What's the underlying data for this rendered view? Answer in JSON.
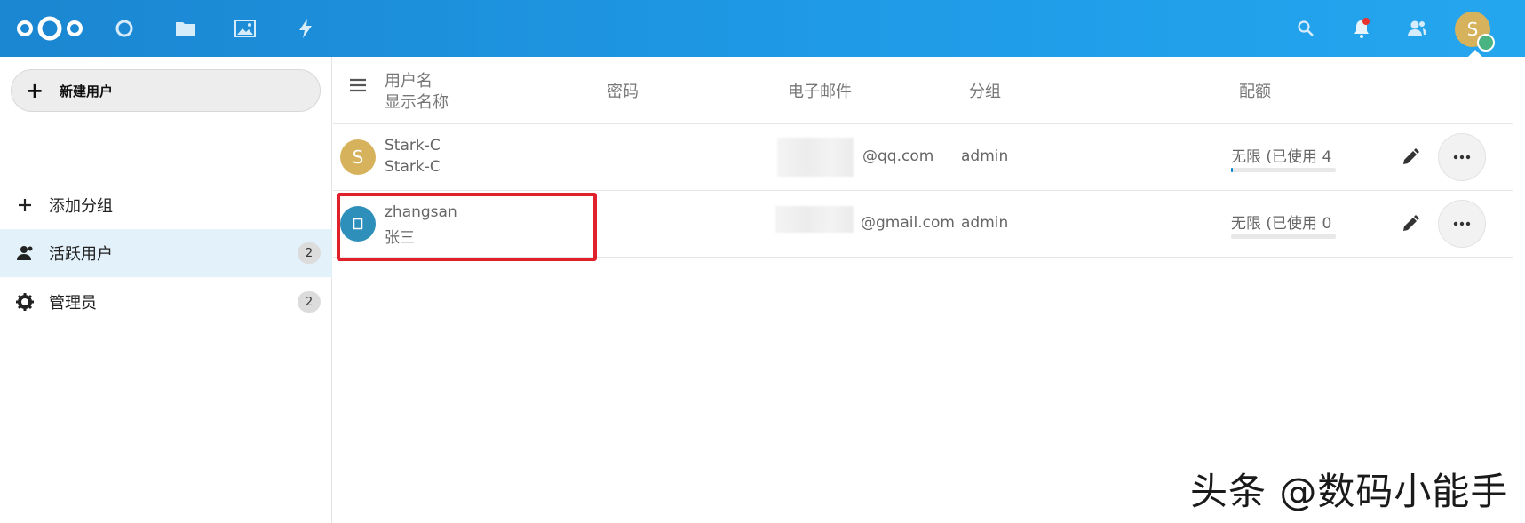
{
  "colors": {
    "header": "#1f9ae6",
    "accent": "#0082c9",
    "highlight": "#e0202a",
    "avatar_stark": "#d7b25c",
    "avatar_zhangsan": "#2e8fba",
    "notification_dot": "#e9322d",
    "status_online": "#49b382"
  },
  "header": {
    "apps": [
      "dashboard-icon",
      "files-icon",
      "photos-icon",
      "activity-icon"
    ],
    "right_icons": [
      "search-icon",
      "bell-icon",
      "contacts-icon"
    ],
    "user_avatar_initial": "S"
  },
  "sidebar": {
    "new_user_label": "新建用户",
    "add_group_label": "添加分组",
    "items": [
      {
        "label": "活跃用户",
        "count": "2",
        "icon": "user-icon",
        "active": true
      },
      {
        "label": "管理员",
        "count": "2",
        "icon": "gear-icon",
        "active": false
      }
    ]
  },
  "table": {
    "headers": {
      "username": "用户名",
      "displayname": "显示名称",
      "password": "密码",
      "email": "电子邮件",
      "groups": "分组",
      "quota": "配额"
    },
    "rows": [
      {
        "avatar_initial": "S",
        "username": "Stark-C",
        "displayname": "Stark-C",
        "email": "@qq.com",
        "group": "admin",
        "quota": "无限 (已使用 4",
        "quota_used_fraction": 0.01
      },
      {
        "avatar_initial": "",
        "username": "zhangsan",
        "displayname": "张三",
        "email": "@gmail.com",
        "group": "admin",
        "quota": "无限 (已使用 0",
        "quota_used_fraction": 0
      }
    ]
  },
  "watermark": "头条 @数码小能手"
}
